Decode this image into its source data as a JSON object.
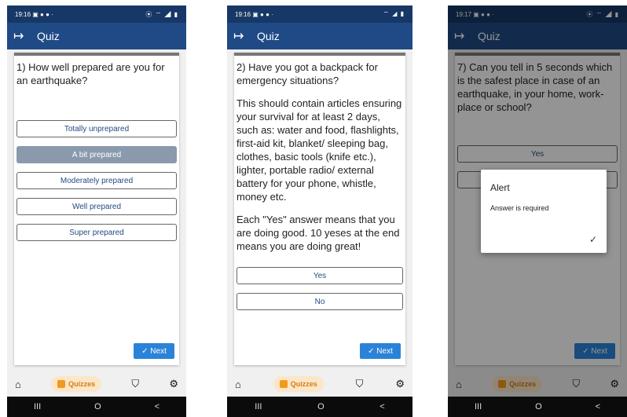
{
  "screens": [
    {
      "status": {
        "time": "19:16 ▣ ● ●  ·",
        "right": "⦿ ⌔ ◢ ▮"
      },
      "appbar": {
        "title": "Quiz",
        "exit_icon": "logout-icon"
      },
      "question": "1) How well prepared are you for an earthquake?",
      "description": "",
      "options": [
        "Totally unprepared",
        "A bit prepared",
        "Moderately prepared",
        "Well prepared",
        "Super prepared"
      ],
      "selected_option": "A bit prepared",
      "next_label": "✓  Next",
      "nav": {
        "quizzes_label": "Quizzes"
      },
      "sysnav": [
        "III",
        "O",
        "<"
      ]
    },
    {
      "status": {
        "time": "19:16 ▣ ● ●  ·",
        "right": "⌔ ◢ ▮"
      },
      "appbar": {
        "title": "Quiz",
        "exit_icon": "logout-icon"
      },
      "question": "2) Have you got a backpack for emergency situations?",
      "description1": "This should contain articles ensuring your survival for at least 2 days, such as: water and food, flashlights, first-aid kit, blanket/ sleeping bag, clothes, basic tools (knife etc.), lighter, portable radio/ external battery for your phone, whistle, money etc.",
      "description2": "Each \"Yes\" answer means that you are doing good. 10 yeses at the end means you are doing great!",
      "options": [
        "Yes",
        "No"
      ],
      "next_label": "✓  Next",
      "nav": {
        "quizzes_label": "Quizzes"
      },
      "sysnav": [
        "III",
        "O",
        "<"
      ]
    },
    {
      "status": {
        "time": "19:17 ▣ ● ●  ·",
        "right": "⦿ ⌔ ◢ ▮"
      },
      "appbar": {
        "title": "Quiz",
        "exit_icon": "logout-icon"
      },
      "question": "7) Can you tell in 5 seconds which is the safest place in case of an earthquake, in your home, work-place or school?",
      "options": [
        "Yes"
      ],
      "next_label": "✓  Next",
      "nav": {
        "quizzes_label": "Quizzes"
      },
      "sysnav": [
        "III",
        "O",
        "<"
      ],
      "alert": {
        "title": "Alert",
        "message": "Answer is required",
        "ok_label": "✓"
      }
    }
  ],
  "colors": {
    "appbar": "#1f4a86",
    "statusbar": "#173866",
    "accent": "#2b83d9",
    "selected": "#8a9aac",
    "quizzes_bg": "#fbe6c8",
    "quizzes_fg": "#d77b12"
  }
}
